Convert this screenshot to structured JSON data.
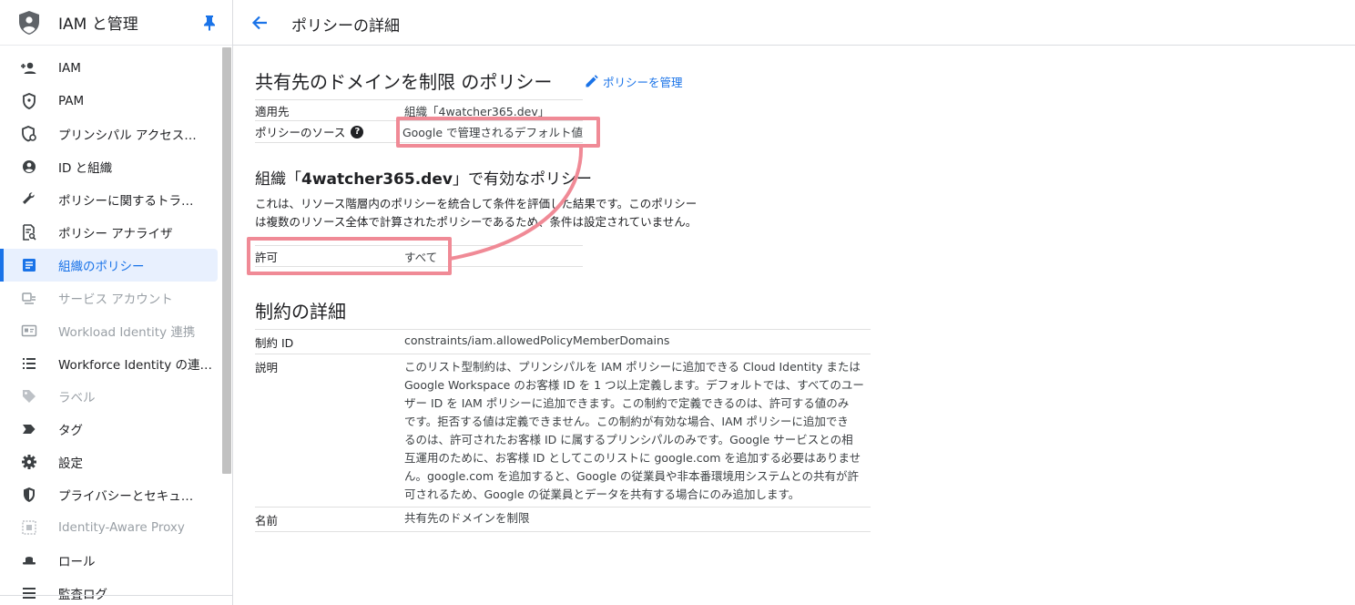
{
  "app": {
    "title": "IAM と管理"
  },
  "sidebar": {
    "items": [
      {
        "label": "IAM",
        "icon": "person-add-icon",
        "state": "normal"
      },
      {
        "label": "PAM",
        "icon": "shield-outline-icon",
        "state": "normal"
      },
      {
        "label": "プリンシパル アクセス…",
        "icon": "shield-policy-icon",
        "state": "normal"
      },
      {
        "label": "ID と組織",
        "icon": "account-circle-icon",
        "state": "normal"
      },
      {
        "label": "ポリシーに関するトラ…",
        "icon": "wrench-icon",
        "state": "normal"
      },
      {
        "label": "ポリシー アナライザ",
        "icon": "document-search-icon",
        "state": "normal"
      },
      {
        "label": "組織のポリシー",
        "icon": "list-box-icon",
        "state": "active"
      },
      {
        "label": "サービス アカウント",
        "icon": "service-account-icon",
        "state": "disabled"
      },
      {
        "label": "Workload Identity 連携",
        "icon": "id-card-icon",
        "state": "disabled"
      },
      {
        "label": "Workforce Identity の連…",
        "icon": "list-icon",
        "state": "normal"
      },
      {
        "label": "ラベル",
        "icon": "label-icon",
        "state": "disabled"
      },
      {
        "label": "タグ",
        "icon": "tag-icon",
        "state": "normal"
      },
      {
        "label": "設定",
        "icon": "gear-icon",
        "state": "normal"
      },
      {
        "label": "プライバシーとセキュ…",
        "icon": "privacy-shield-icon",
        "state": "normal"
      },
      {
        "label": "Identity-Aware Proxy",
        "icon": "proxy-icon",
        "state": "disabled"
      },
      {
        "label": "ロール",
        "icon": "hat-icon",
        "state": "normal"
      },
      {
        "label": "監査ログ",
        "icon": "audit-log-icon",
        "state": "normal"
      }
    ]
  },
  "topbar": {
    "title": "ポリシーの詳細"
  },
  "policy": {
    "heading": "共有先のドメインを制限 のポリシー",
    "manage_label": "ポリシーを管理",
    "applies_to_label": "適用先",
    "applies_to_value": "組織「4watcher365.dev」",
    "source_label": "ポリシーのソース",
    "source_value": "Google で管理されるデフォルト値"
  },
  "effective": {
    "heading_prefix": "組織「",
    "heading_org": "4watcher365.dev",
    "heading_suffix": "」で有効なポリシー",
    "description_line1": "これは、リソース階層内のポリシーを統合して条件を評価した結果です。このポリシー",
    "description_line2": "は複数のリソース全体で計算されたポリシーであるため、条件は設定されていません。",
    "allow_label": "許可",
    "allow_value": "すべて"
  },
  "constraint": {
    "heading": "制約の詳細",
    "id_label": "制約 ID",
    "id_value": "constraints/iam.allowedPolicyMemberDomains",
    "description_label": "説明",
    "description_lines": [
      "このリスト型制約は、プリンシパルを IAM ポリシーに追加できる Cloud Identity または",
      "Google Workspace のお客様 ID を 1 つ以上定義します。デフォルトでは、すべてのユー",
      "ザー ID を IAM ポリシーに追加できます。この制約で定義できるのは、許可する値のみ",
      "です。拒否する値は定義できません。この制約が有効な場合、IAM ポリシーに追加でき",
      "るのは、許可されたお客様 ID に属するプリンシパルのみです。Google サービスとの相",
      "互運用のために、お客様 ID としてこのリストに google.com を追加する必要はありませ",
      "ん。google.com を追加すると、Google の従業員や非本番環境用システムとの共有が許",
      "可されるため、Google の従業員とデータを共有する場合にのみ追加します。"
    ],
    "name_label": "名前",
    "name_value": "共有先のドメインを制限"
  },
  "colors": {
    "accent": "#1a73e8",
    "highlight": "#f08a96",
    "active_bg": "#e8f0fe"
  }
}
